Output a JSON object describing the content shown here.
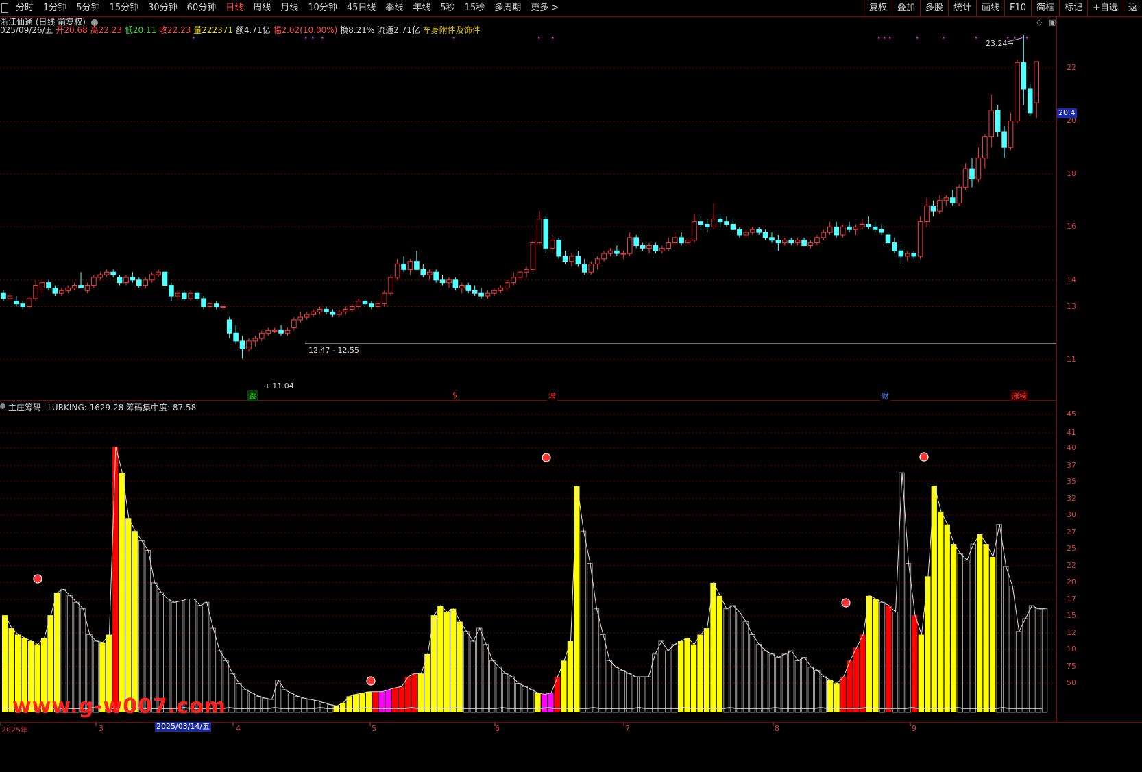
{
  "toolbar": {
    "periods": [
      "分时",
      "1分钟",
      "5分钟",
      "15分钟",
      "30分钟",
      "60分钟",
      "日线",
      "周线",
      "月线",
      "10分钟",
      "45日线",
      "季线",
      "年线",
      "5秒",
      "15秒",
      "多周期",
      "更多 >"
    ],
    "active_period": "日线",
    "right_buttons": [
      "复权",
      "叠加",
      "多股",
      "统计",
      "画线",
      "F10",
      "简框",
      "标记",
      "+自选",
      "返"
    ]
  },
  "stock": {
    "title": "浙江仙通 (日线 前复权)",
    "date": "025/09/26/五",
    "open_label": "开",
    "open": "20.68",
    "high_label": "高",
    "high": "22.23",
    "low_label": "低",
    "low": "20.11",
    "close_label": "收",
    "close": "22.23",
    "volume_label": "量",
    "volume": "222371",
    "amount_label": "额",
    "amount": "4.71亿",
    "change_label": "幅",
    "change": "2.02(10.00%)",
    "turnover_label": "换",
    "turnover": "8.21%",
    "float_label": "流通",
    "float_cap": "2.71亿",
    "sector": "车身附件及饰件"
  },
  "price_axis": [
    "22",
    "20",
    "18",
    "16",
    "14",
    "13",
    "11"
  ],
  "current_price_tag": "20.4",
  "annotations": {
    "range": "12.47 - 12.55",
    "low": "11.04",
    "high": "23.24"
  },
  "event_tags": [
    {
      "text": "跌",
      "color": "#2ecc2e",
      "bg": "#0b3b0b"
    },
    {
      "text": "$",
      "color": "#ff3030",
      "bg": "#000"
    },
    {
      "text": "增",
      "color": "#ff3030",
      "bg": "#000"
    },
    {
      "text": "财",
      "color": "#3a7cff",
      "bg": "#000"
    },
    {
      "text": "涨榜",
      "color": "#ff3030",
      "bg": "#3a0000"
    }
  ],
  "indicator": {
    "name": "主庄筹码",
    "values_text": "LURKING: 1629.28  筹码集中度: 87.58"
  },
  "indicator_axis": [
    "45",
    "41",
    "40",
    "37",
    "35",
    "32",
    "30",
    "27",
    "25",
    "22",
    "20",
    "17",
    "15",
    "12",
    "10",
    "75",
    "50"
  ],
  "dates": {
    "ticks": [
      "2025年",
      "3",
      "4",
      "5",
      "6",
      "7",
      "8",
      "9"
    ],
    "current": "2025/03/14/五"
  },
  "watermark": "www.g-w007.com",
  "colors": {
    "up": "#ff3a3a",
    "down": "#54ffff",
    "grid": "#7a0000",
    "bar_yellow": "#ffff00",
    "bar_red": "#ff0000",
    "bar_magenta": "#ff00ff",
    "bar_gray": "#9a9a9a"
  },
  "chart_data": [
    {
      "type": "candlestick",
      "title": "浙江仙通 (日线 前复权)",
      "ylim": [
        10,
        24
      ],
      "ohlc": [
        [
          13.5,
          13.6,
          13.2,
          13.3
        ],
        [
          13.3,
          13.5,
          13.2,
          13.4
        ],
        [
          13.2,
          13.4,
          13.0,
          13.1
        ],
        [
          13.1,
          13.2,
          12.9,
          13.0
        ],
        [
          13.0,
          13.4,
          12.9,
          13.3
        ],
        [
          13.3,
          14.0,
          13.2,
          13.8
        ],
        [
          13.7,
          14.0,
          13.5,
          13.9
        ],
        [
          13.9,
          14.0,
          13.6,
          13.7
        ],
        [
          13.7,
          13.8,
          13.4,
          13.5
        ],
        [
          13.5,
          13.7,
          13.4,
          13.6
        ],
        [
          13.6,
          13.8,
          13.5,
          13.7
        ],
        [
          13.7,
          13.9,
          13.6,
          13.8
        ],
        [
          13.8,
          14.3,
          13.7,
          13.7
        ],
        [
          13.6,
          13.9,
          13.5,
          13.8
        ],
        [
          13.8,
          14.2,
          13.7,
          14.1
        ],
        [
          14.1,
          14.3,
          14.0,
          14.2
        ],
        [
          14.2,
          14.4,
          14.1,
          14.3
        ],
        [
          14.3,
          14.4,
          14.1,
          14.2
        ],
        [
          14.1,
          14.2,
          13.8,
          13.9
        ],
        [
          13.9,
          14.2,
          13.8,
          14.1
        ],
        [
          14.1,
          14.3,
          13.9,
          14.0
        ],
        [
          14.0,
          14.1,
          13.7,
          13.8
        ],
        [
          13.8,
          14.1,
          13.7,
          14.0
        ],
        [
          14.0,
          14.3,
          13.9,
          14.2
        ],
        [
          14.2,
          14.4,
          14.1,
          14.3
        ],
        [
          14.3,
          14.4,
          13.8,
          13.8
        ],
        [
          13.8,
          13.9,
          13.2,
          13.4
        ],
        [
          13.4,
          13.6,
          13.2,
          13.5
        ],
        [
          13.5,
          13.6,
          13.2,
          13.3
        ],
        [
          13.3,
          13.6,
          13.2,
          13.5
        ],
        [
          13.5,
          13.6,
          13.2,
          13.3
        ],
        [
          13.3,
          13.4,
          12.9,
          13.0
        ],
        [
          13.0,
          13.2,
          12.9,
          13.1
        ],
        [
          13.1,
          13.2,
          12.9,
          13.0
        ],
        [
          13.0,
          13.1,
          12.9,
          13.0
        ],
        [
          12.5,
          12.6,
          11.8,
          12.0
        ],
        [
          12.0,
          12.3,
          11.6,
          11.7
        ],
        [
          11.7,
          11.9,
          11.04,
          11.4
        ],
        [
          11.4,
          11.8,
          11.3,
          11.7
        ],
        [
          11.7,
          11.9,
          11.5,
          11.8
        ],
        [
          11.8,
          12.1,
          11.7,
          12.0
        ],
        [
          12.0,
          12.2,
          11.9,
          12.1
        ],
        [
          12.1,
          12.2,
          12.0,
          12.1
        ],
        [
          12.1,
          12.3,
          11.9,
          12.0
        ],
        [
          12.0,
          12.2,
          11.9,
          12.1
        ],
        [
          12.2,
          12.6,
          12.1,
          12.5
        ],
        [
          12.5,
          12.8,
          12.4,
          12.6
        ],
        [
          12.6,
          12.8,
          12.5,
          12.7
        ],
        [
          12.7,
          12.9,
          12.6,
          12.8
        ],
        [
          12.8,
          13.0,
          12.7,
          12.9
        ],
        [
          12.9,
          13.0,
          12.7,
          12.8
        ],
        [
          12.8,
          12.9,
          12.6,
          12.7
        ],
        [
          12.7,
          12.9,
          12.6,
          12.8
        ],
        [
          12.8,
          13.0,
          12.7,
          12.9
        ],
        [
          12.9,
          13.1,
          12.8,
          13.0
        ],
        [
          13.0,
          13.3,
          12.9,
          13.2
        ],
        [
          13.2,
          13.3,
          13.0,
          13.1
        ],
        [
          13.1,
          13.2,
          12.9,
          13.0
        ],
        [
          13.0,
          13.2,
          12.9,
          13.1
        ],
        [
          13.1,
          13.6,
          13.0,
          13.5
        ],
        [
          13.5,
          14.2,
          13.4,
          14.1
        ],
        [
          14.1,
          14.8,
          14.0,
          14.6
        ],
        [
          14.6,
          14.9,
          14.3,
          14.4
        ],
        [
          14.4,
          14.8,
          14.2,
          14.7
        ],
        [
          14.7,
          15.1,
          14.4,
          14.4
        ],
        [
          14.4,
          14.6,
          14.1,
          14.2
        ],
        [
          14.2,
          14.4,
          14.0,
          14.3
        ],
        [
          14.3,
          14.4,
          13.9,
          14.0
        ],
        [
          14.0,
          14.2,
          13.8,
          13.9
        ],
        [
          13.9,
          14.1,
          13.7,
          14.0
        ],
        [
          14.0,
          14.1,
          13.6,
          13.7
        ],
        [
          13.7,
          13.9,
          13.5,
          13.8
        ],
        [
          13.8,
          13.9,
          13.5,
          13.6
        ],
        [
          13.6,
          13.8,
          13.4,
          13.5
        ],
        [
          13.5,
          13.7,
          13.3,
          13.4
        ],
        [
          13.4,
          13.6,
          13.3,
          13.5
        ],
        [
          13.5,
          13.7,
          13.4,
          13.6
        ],
        [
          13.6,
          13.8,
          13.5,
          13.7
        ],
        [
          13.7,
          14.0,
          13.6,
          13.9
        ],
        [
          13.9,
          14.3,
          13.8,
          14.1
        ],
        [
          14.1,
          14.4,
          14.0,
          14.3
        ],
        [
          14.3,
          14.5,
          14.1,
          14.4
        ],
        [
          14.4,
          15.6,
          14.3,
          15.4
        ],
        [
          15.4,
          16.6,
          15.3,
          16.3
        ],
        [
          16.3,
          16.4,
          15.0,
          15.2
        ],
        [
          15.2,
          15.7,
          15.0,
          15.5
        ],
        [
          15.5,
          15.6,
          14.8,
          14.9
        ],
        [
          14.9,
          15.1,
          14.6,
          14.7
        ],
        [
          14.7,
          15.0,
          14.5,
          14.9
        ],
        [
          14.9,
          15.1,
          14.5,
          14.6
        ],
        [
          14.6,
          14.8,
          14.2,
          14.3
        ],
        [
          14.3,
          14.7,
          14.2,
          14.6
        ],
        [
          14.6,
          14.9,
          14.4,
          14.8
        ],
        [
          14.8,
          15.1,
          14.7,
          15.0
        ],
        [
          15.0,
          15.2,
          14.9,
          15.1
        ],
        [
          15.1,
          15.3,
          14.9,
          15.0
        ],
        [
          15.0,
          15.1,
          14.8,
          15.0
        ],
        [
          15.0,
          15.8,
          14.9,
          15.6
        ],
        [
          15.6,
          15.7,
          15.2,
          15.3
        ],
        [
          15.3,
          15.4,
          15.1,
          15.2
        ],
        [
          15.2,
          15.4,
          15.0,
          15.3
        ],
        [
          15.3,
          15.4,
          15.0,
          15.1
        ],
        [
          15.1,
          15.3,
          15.0,
          15.2
        ],
        [
          15.2,
          15.6,
          15.1,
          15.4
        ],
        [
          15.4,
          15.8,
          15.3,
          15.6
        ],
        [
          15.6,
          15.8,
          15.3,
          15.4
        ],
        [
          15.4,
          15.6,
          15.3,
          15.5
        ],
        [
          15.5,
          16.5,
          15.4,
          16.2
        ],
        [
          16.2,
          16.4,
          15.9,
          16.1
        ],
        [
          16.1,
          16.3,
          15.8,
          16.0
        ],
        [
          16.0,
          16.9,
          15.9,
          16.3
        ],
        [
          16.3,
          16.5,
          16.0,
          16.2
        ],
        [
          16.2,
          16.4,
          16.0,
          16.1
        ],
        [
          16.1,
          16.3,
          15.8,
          15.9
        ],
        [
          15.9,
          16.0,
          15.6,
          15.7
        ],
        [
          15.7,
          15.9,
          15.6,
          15.8
        ],
        [
          15.8,
          16.0,
          15.7,
          15.9
        ],
        [
          15.9,
          16.0,
          15.7,
          15.8
        ],
        [
          15.8,
          15.9,
          15.5,
          15.6
        ],
        [
          15.6,
          15.8,
          15.4,
          15.5
        ],
        [
          15.5,
          15.7,
          15.1,
          15.4
        ],
        [
          15.4,
          15.6,
          15.3,
          15.5
        ],
        [
          15.5,
          15.6,
          15.3,
          15.4
        ],
        [
          15.4,
          15.6,
          15.3,
          15.5
        ],
        [
          15.5,
          15.6,
          15.3,
          15.3
        ],
        [
          15.3,
          15.5,
          15.2,
          15.4
        ],
        [
          15.4,
          15.7,
          15.3,
          15.6
        ],
        [
          15.6,
          15.9,
          15.5,
          15.8
        ],
        [
          15.8,
          16.2,
          15.7,
          16.0
        ],
        [
          16.0,
          16.2,
          15.6,
          15.7
        ],
        [
          15.7,
          16.1,
          15.6,
          16.0
        ],
        [
          16.0,
          16.2,
          15.8,
          15.9
        ],
        [
          15.9,
          16.1,
          15.7,
          16.0
        ],
        [
          16.0,
          16.3,
          15.9,
          16.1
        ],
        [
          16.1,
          16.4,
          15.9,
          16.0
        ],
        [
          16.0,
          16.2,
          15.8,
          15.9
        ],
        [
          15.9,
          16.1,
          15.7,
          15.8
        ],
        [
          15.7,
          15.8,
          15.3,
          15.4
        ],
        [
          15.4,
          15.6,
          15.0,
          15.1
        ],
        [
          15.1,
          15.3,
          14.6,
          14.9
        ],
        [
          14.9,
          15.1,
          14.7,
          15.0
        ],
        [
          15.0,
          15.1,
          14.8,
          14.9
        ],
        [
          14.9,
          16.4,
          14.8,
          16.2
        ],
        [
          16.2,
          17.1,
          16.0,
          16.8
        ],
        [
          16.8,
          17.0,
          16.4,
          16.6
        ],
        [
          16.6,
          17.2,
          16.5,
          17.0
        ],
        [
          17.0,
          17.2,
          16.8,
          17.1
        ],
        [
          17.1,
          17.4,
          16.8,
          16.9
        ],
        [
          16.9,
          17.6,
          16.8,
          17.5
        ],
        [
          17.5,
          18.4,
          17.4,
          18.2
        ],
        [
          18.2,
          18.6,
          17.5,
          17.8
        ],
        [
          17.8,
          19.0,
          17.7,
          18.6
        ],
        [
          18.6,
          19.5,
          18.2,
          19.4
        ],
        [
          19.4,
          21.0,
          19.0,
          20.4
        ],
        [
          20.4,
          20.6,
          19.4,
          19.6
        ],
        [
          19.6,
          19.8,
          18.6,
          19.0
        ],
        [
          19.0,
          20.3,
          18.9,
          20.0
        ],
        [
          20.0,
          22.3,
          19.9,
          22.2
        ],
        [
          22.2,
          23.24,
          20.6,
          21.2
        ],
        [
          21.2,
          21.4,
          20.2,
          20.3
        ],
        [
          20.68,
          22.23,
          20.11,
          22.23
        ]
      ]
    },
    {
      "type": "bar",
      "title": "主庄筹码",
      "ylim": [
        0,
        460
      ],
      "values": [
        150,
        130,
        120,
        115,
        110,
        105,
        115,
        150,
        185,
        190,
        180,
        170,
        160,
        120,
        110,
        108,
        120,
        410,
        370,
        300,
        280,
        265,
        250,
        200,
        185,
        175,
        170,
        172,
        175,
        175,
        165,
        170,
        130,
        95,
        80,
        60,
        45,
        35,
        30,
        25,
        22,
        20,
        50,
        35,
        30,
        25,
        22,
        20,
        18,
        15,
        12,
        10,
        15,
        25,
        28,
        30,
        32,
        32,
        32,
        35,
        38,
        40,
        55,
        60,
        60,
        90,
        150,
        165,
        155,
        160,
        140,
        125,
        110,
        130,
        105,
        80,
        70,
        60,
        55,
        45,
        40,
        35,
        30,
        28,
        30,
        55,
        80,
        110,
        350,
        280,
        230,
        160,
        120,
        80,
        70,
        65,
        60,
        55,
        55,
        55,
        90,
        110,
        95,
        105,
        110,
        115,
        105,
        120,
        130,
        200,
        180,
        160,
        165,
        155,
        140,
        120,
        105,
        95,
        90,
        85,
        90,
        95,
        80,
        85,
        70,
        65,
        55,
        50,
        45,
        55,
        80,
        100,
        120,
        180,
        175,
        170,
        165,
        155,
        370,
        230,
        150,
        120,
        210,
        350,
        310,
        290,
        260,
        245,
        235,
        260,
        275,
        260,
        240,
        290,
        225,
        195,
        125,
        145,
        165,
        160,
        160
      ],
      "series_kinds": "gray/yellow/red/magenta"
    }
  ]
}
